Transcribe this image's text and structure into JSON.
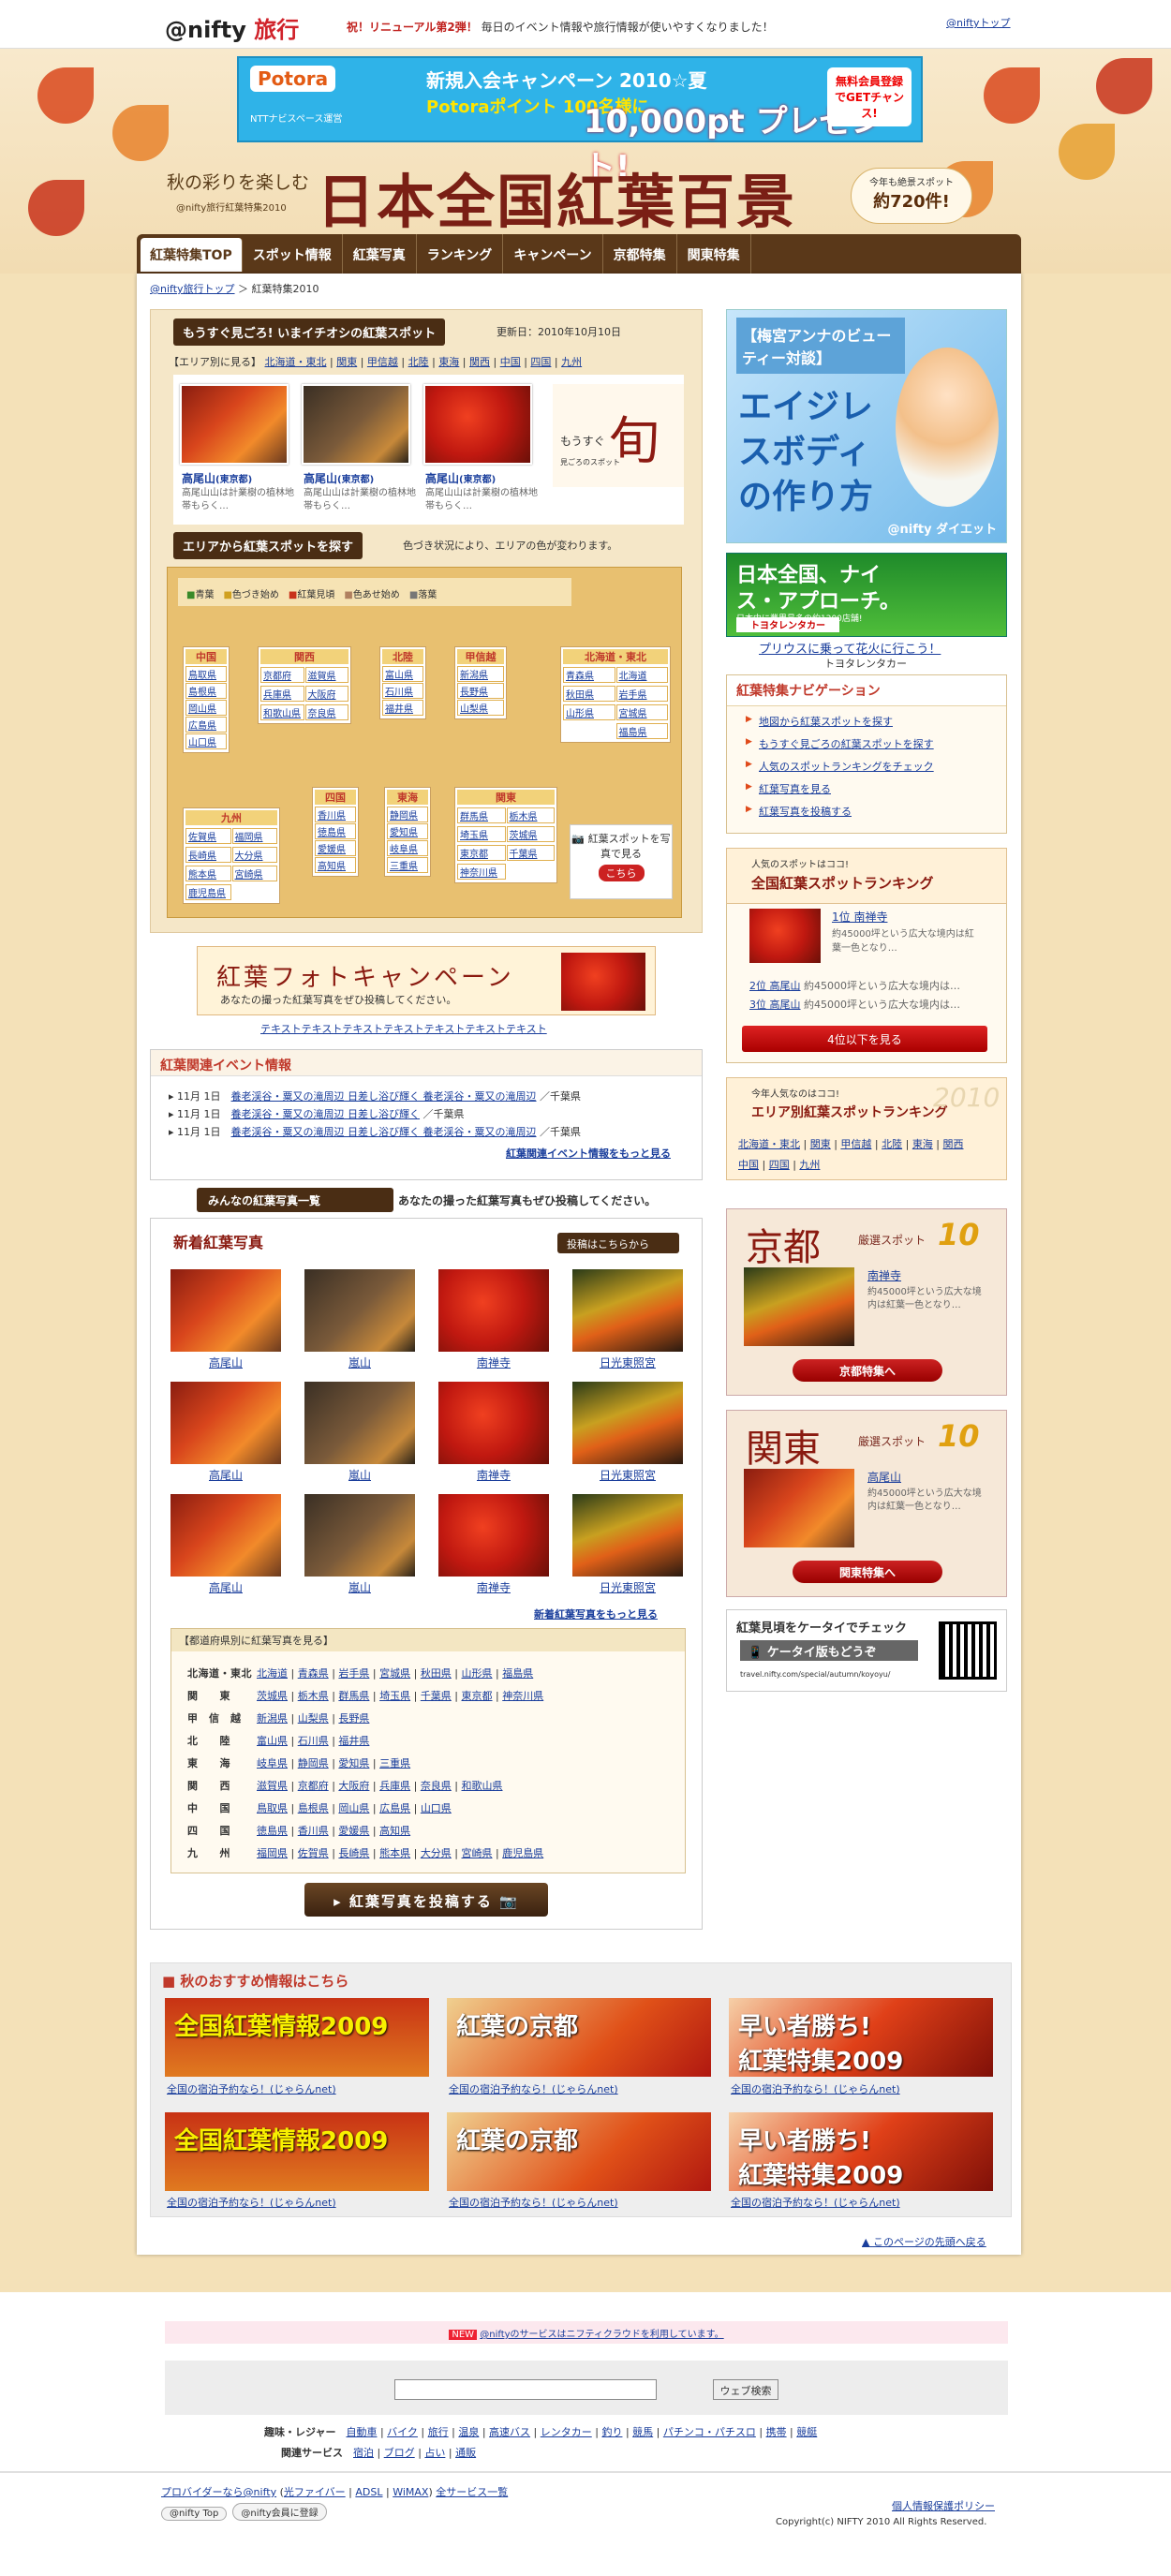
{
  "header": {
    "logo": "@nifty",
    "logo_travel": "旅行",
    "renew_bold": "祝！リニューアル第2弾！",
    "renew_text": "毎日のイベント情報や旅行情報が使いやすくなりました！",
    "top_link": "@niftyトップ"
  },
  "promo": {
    "brand": "Potora",
    "sub": "NTTナビスペース運営",
    "line1": "新規入会キャンペーン 2010☆夏",
    "line2": "Potoraポイント 100名様に",
    "line3": "10,000pt プレゼント!",
    "side": "無料会員登録でGETチャンス!"
  },
  "title": {
    "autumn": "秋の彩りを楽しむ",
    "sub": "@nifty旅行紅葉特集2010",
    "main": "日本全国紅葉百景",
    "badge_small": "今年も絶景スポット",
    "badge_big": "約720件!"
  },
  "nav": [
    "紅葉特集TOP",
    "スポット情報",
    "紅葉写真",
    "ランキング",
    "キャンペーン",
    "京都特集",
    "関東特集"
  ],
  "breadcrumb": {
    "home": "@nifty旅行トップ",
    "current": "紅葉特集2010"
  },
  "feature": {
    "head": "もうすぐ見ごろ! いまイチオシの紅葉スポット",
    "updated": "更新日：2010年10月10日",
    "area_label": "【エリア別に見る】",
    "areas": [
      "北海道・東北",
      "関東",
      "甲信越",
      "北陸",
      "東海",
      "関西",
      "中国",
      "四国",
      "九州"
    ],
    "spots": [
      {
        "name": "高尾山",
        "area": "(東京都)",
        "desc": "高尾山山は計業樹の植林地帯もらく…"
      },
      {
        "name": "高尾山",
        "area": "(東京都)",
        "desc": "高尾山山は計業樹の植林地帯もらく…"
      },
      {
        "name": "高尾山",
        "area": "(東京都)",
        "desc": "高尾山山は計業樹の植林地帯もらく…"
      }
    ],
    "shun_prefix": "もうすぐ",
    "shun": "旬",
    "shun_sub": "見ごろのスポット"
  },
  "map": {
    "head": "エリアから紅葉スポットを探す",
    "note": "色づき状況により、エリアの色が変わります。",
    "legend": [
      "青葉",
      "色づき始め",
      "紅葉見頃",
      "色あせ始め",
      "落葉"
    ],
    "regions": [
      {
        "name": "中国",
        "prefs": [
          "鳥取県",
          "島根県",
          "岡山県",
          "広島県",
          "山口県"
        ]
      },
      {
        "name": "関西",
        "prefs": [
          "京都府",
          "滋賀県",
          "兵庫県",
          "大阪府",
          "和歌山県",
          "奈良県"
        ]
      },
      {
        "name": "北陸",
        "prefs": [
          "富山県",
          "石川県",
          "福井県"
        ]
      },
      {
        "name": "甲信越",
        "prefs": [
          "新潟県",
          "長野県",
          "山梨県"
        ]
      },
      {
        "name": "北海道・東北",
        "prefs": [
          "青森県",
          "北海道",
          "秋田県",
          "岩手県",
          "山形県",
          "宮城県",
          "福島県"
        ]
      },
      {
        "name": "九州",
        "prefs": [
          "佐賀県",
          "福岡県",
          "長崎県",
          "大分県",
          "熊本県",
          "宮崎県",
          "鹿児島県"
        ]
      },
      {
        "name": "四国",
        "prefs": [
          "香川県",
          "徳島県",
          "愛媛県",
          "高知県"
        ]
      },
      {
        "name": "東海",
        "prefs": [
          "静岡県",
          "愛知県",
          "岐阜県",
          "三重県"
        ]
      },
      {
        "name": "関東",
        "prefs": [
          "群馬県",
          "栃木県",
          "埼玉県",
          "茨城県",
          "東京都",
          "千葉県",
          "神奈川県"
        ]
      }
    ],
    "photo_badge": "紅葉スポットを写真で見る",
    "photo_btn": "こちら"
  },
  "campaign": {
    "title": "紅葉フォトキャンペーン",
    "sub": "あなたの撮った紅葉写真をぜひ投稿してください。",
    "link": "テキストテキストテキストテキストテキストテキストテキスト"
  },
  "events": {
    "head": "紅葉関連イベント情報",
    "rows": [
      {
        "date": "11月 1日",
        "title": "養老渓谷・粟又の滝周辺 日差し浴び輝く 養老渓谷・粟又の滝周辺",
        "loc": "／千葉県"
      },
      {
        "date": "11月 1日",
        "title": "養老渓谷・粟又の滝周辺 日差し浴び輝く",
        "loc": "／千葉県"
      },
      {
        "date": "11月 1日",
        "title": "養老渓谷・粟又の滝周辺 日差し浴び輝く 養老渓谷・粟又の滝周辺",
        "loc": "／千葉県"
      }
    ],
    "more": "紅葉関連イベント情報をもっと見る"
  },
  "photos": {
    "section": "みんなの紅葉写真一覧",
    "section_note": "あなたの撮った紅葉写真もぜひ投稿してください。",
    "title": "新着紅葉写真",
    "post": "投稿はこちらから",
    "labels": [
      "高尾山",
      "嵐山",
      "南禅寺",
      "日光東照宮"
    ],
    "more": "新着紅葉写真をもっと見る",
    "pref_head": "【都道府県別に紅葉写真を見る】",
    "pref_rows": [
      {
        "r": "北海道・東北",
        "p": [
          "北海道",
          "青森県",
          "岩手県",
          "宮城県",
          "秋田県",
          "山形県",
          "福島県"
        ]
      },
      {
        "r": "関　　東",
        "p": [
          "茨城県",
          "栃木県",
          "群馬県",
          "埼玉県",
          "千葉県",
          "東京都",
          "神奈川県"
        ]
      },
      {
        "r": "甲　信　越",
        "p": [
          "新潟県",
          "山梨県",
          "長野県"
        ]
      },
      {
        "r": "北　　陸",
        "p": [
          "富山県",
          "石川県",
          "福井県"
        ]
      },
      {
        "r": "東　　海",
        "p": [
          "岐阜県",
          "静岡県",
          "愛知県",
          "三重県"
        ]
      },
      {
        "r": "関　　西",
        "p": [
          "滋賀県",
          "京都府",
          "大阪府",
          "兵庫県",
          "奈良県",
          "和歌山県"
        ]
      },
      {
        "r": "中　　国",
        "p": [
          "鳥取県",
          "島根県",
          "岡山県",
          "広島県",
          "山口県"
        ]
      },
      {
        "r": "四　　国",
        "p": [
          "徳島県",
          "香川県",
          "愛媛県",
          "高知県"
        ]
      },
      {
        "r": "九　　州",
        "p": [
          "福岡県",
          "佐賀県",
          "長崎県",
          "熊本県",
          "大分県",
          "宮崎県",
          "鹿児島県"
        ]
      }
    ],
    "upload": "紅葉写真を投稿する"
  },
  "right": {
    "beauty_head": "【梅宮アンナのビューティー対談】",
    "beauty_copy": "エイジレスボディの作り方",
    "beauty_tag": "@nifty ダイエット",
    "golf_title": "日本全国、ナイス・アプローチ。",
    "golf_sub": "日本中に業界最多の約1200店舗!",
    "golf_brand": "トヨタレンタカー",
    "prius": "プリウスに乗って花火に行こう！",
    "toyota": "トヨタレンタカー",
    "nav_head": "紅葉特集ナビゲーション",
    "nav_items": [
      "地図から紅葉スポットを探す",
      "もうすぐ見ごろの紅葉スポットを探す",
      "人気のスポットランキングをチェック",
      "紅葉写真を見る",
      "紅葉写真を投稿する"
    ],
    "rank_pre": "人気のスポットはココ!",
    "rank_head": "全国紅葉スポットランキング",
    "rank1": "1位 南禅寺",
    "rank1_desc": "約45000坪という広大な境内は紅葉一色となり…",
    "rank2": "2位 高尾山",
    "rank2_desc": "約45000坪という広大な境内は…",
    "rank3": "3位 高尾山",
    "rank3_desc": "約45000坪という広大な境内は…",
    "rank_more": "4位以下を見る",
    "area_pre": "今年人気なのはココ!",
    "area_head": "エリア別紅葉スポットランキング",
    "area_year": "2010",
    "area_links": [
      "北海道・東北",
      "関東",
      "甲信越",
      "北陸",
      "東海",
      "関西",
      "中国",
      "四国",
      "九州"
    ],
    "kyoto": {
      "city": "京都",
      "label": "厳選スポット",
      "n": "10",
      "spot": "南禅寺",
      "desc": "約45000坪という広大な境内は紅葉一色となり…",
      "btn": "京都特集へ"
    },
    "kanto": {
      "city": "関東",
      "label": "厳選スポット",
      "n": "10",
      "spot": "高尾山",
      "desc": "約45000坪という広大な境内は紅葉一色となり…",
      "btn": "関東特集へ"
    },
    "keitai_head": "紅葉見頃をケータイでチェック",
    "keitai_btn": "ケータイ版もどうぞ",
    "keitai_url": "travel.nifty.com/special/autumn/koyoyu/"
  },
  "reco": {
    "head": "秋のおすすめ情報はこちら",
    "banners": [
      {
        "a": "全国",
        "b": "紅葉情報2009"
      },
      {
        "a": "紅葉",
        "b": "の京都"
      },
      {
        "a": "早い者勝ち!",
        "b": "紅葉特集2009"
      },
      {
        "a": "全国",
        "b": "紅葉情報2009"
      },
      {
        "a": "紅葉",
        "b": "の京都"
      },
      {
        "a": "早い者勝ち!",
        "b": "紅葉特集2009"
      }
    ],
    "link": "全国の宿泊予約なら！(じゃらんnet)"
  },
  "pagetop": "このページの先頭へ戻る",
  "footer": {
    "notice": "@niftyのサービスはニフティクラウドを利用しています。",
    "search_btn": "ウェブ検索",
    "hobby_label": "趣味・レジャー",
    "hobby": [
      "自動車",
      "バイク",
      "旅行",
      "温泉",
      "高速バス",
      "レンタカー",
      "釣り",
      "競馬",
      "パチンコ・パチスロ",
      "携帯",
      "競艇"
    ],
    "related_label": "関連サービス",
    "related": [
      "宿泊",
      "ブログ",
      "占い",
      "通販"
    ],
    "provider": "プロバイダーなら@nifty",
    "hikari": "光ファイバー",
    "adsl": "ADSL",
    "wimax": "WiMAX",
    "all": "全サービス一覧",
    "btn1": "@nifty Top",
    "btn2": "@nifty会員に登録",
    "privacy": "個人情報保護ポリシー",
    "copyright": "Copyright(c) NIFTY 2010 All Rights Reserved."
  }
}
